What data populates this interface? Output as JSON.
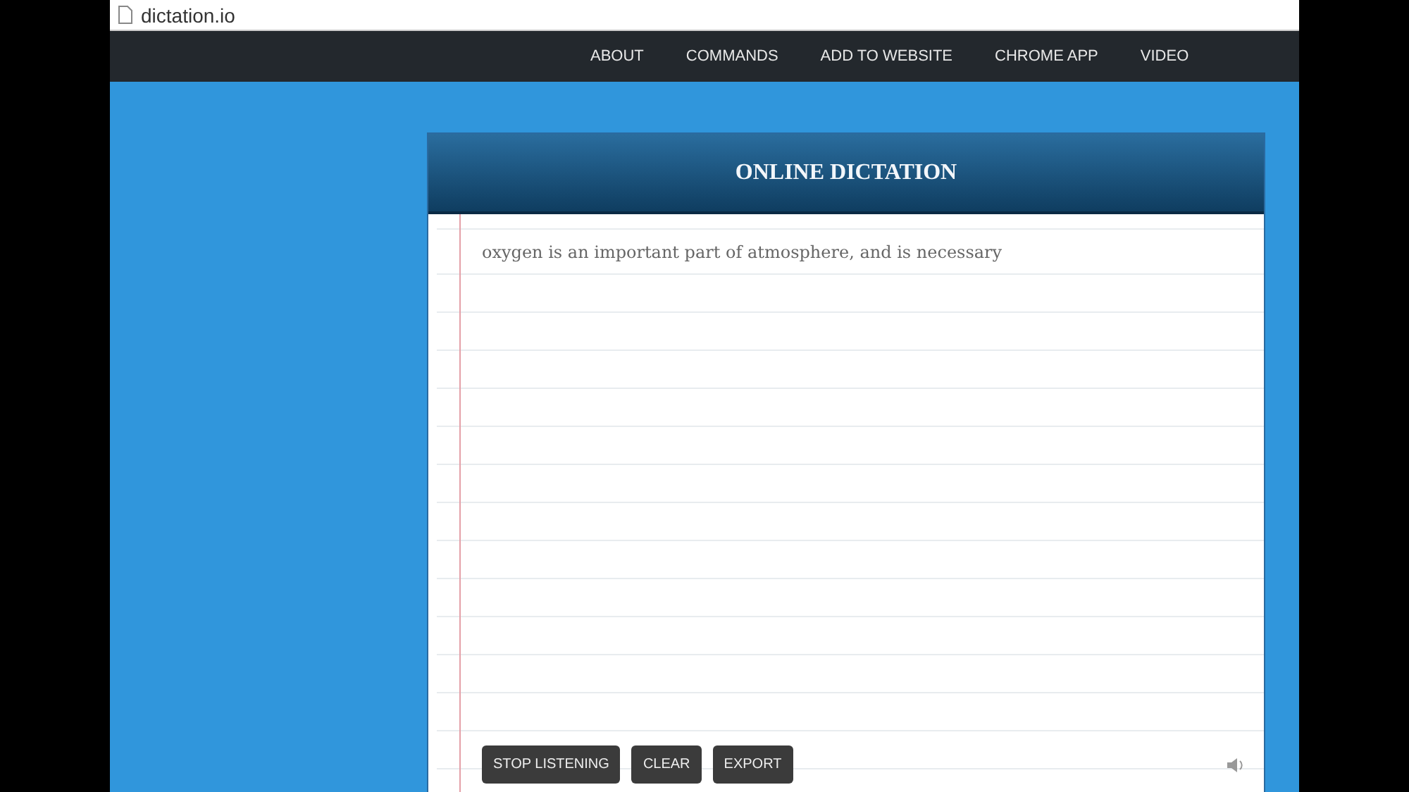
{
  "browser": {
    "address": "dictation.io"
  },
  "nav": {
    "items": [
      "ABOUT",
      "COMMANDS",
      "ADD TO WEBSITE",
      "CHROME APP",
      "VIDEO"
    ]
  },
  "card": {
    "title": "ONLINE DICTATION",
    "text": "oxygen is an important part of atmosphere, and is necessary",
    "buttons": [
      "STOP LISTENING",
      "CLEAR",
      "EXPORT"
    ]
  }
}
